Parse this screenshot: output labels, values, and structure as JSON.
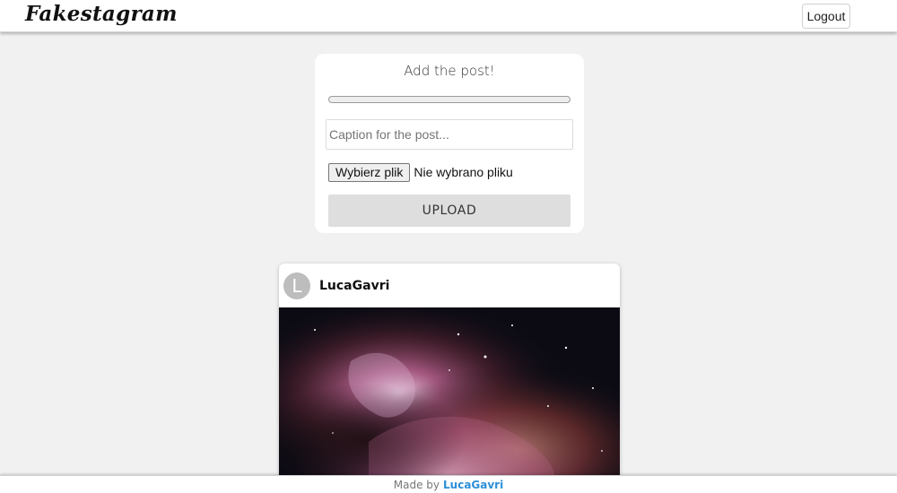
{
  "header": {
    "logo": "Fakestagram",
    "logout_label": "Logout"
  },
  "upload": {
    "title": "Add the post!",
    "progress": 0,
    "caption_placeholder": "Caption for the post...",
    "caption_value": "",
    "file_button_label": "Wybierz plik",
    "file_status": "Nie wybrano pliku",
    "upload_label": "UPLOAD"
  },
  "post": {
    "avatar_letter": "L",
    "username": "LucaGavri",
    "image_icon": "orion-nebula-photo"
  },
  "footer": {
    "made_by": "Made by",
    "author": "LucaGavri"
  },
  "colors": {
    "background": "#f1f1f1",
    "footer_link": "#2b8fd9",
    "upload_button": "#dedede"
  }
}
